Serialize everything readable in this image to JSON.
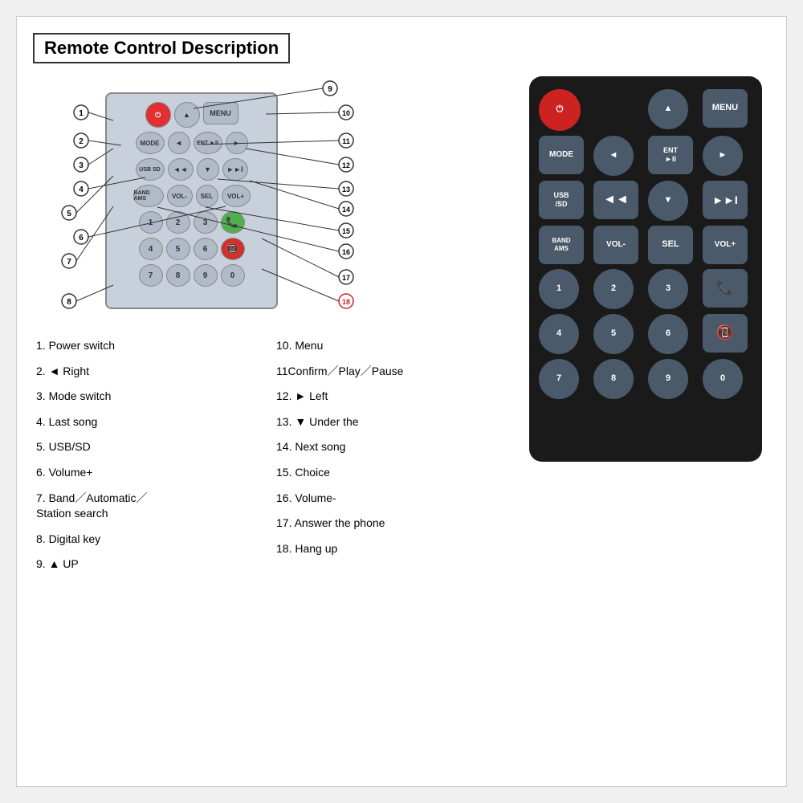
{
  "title": "Remote Control Description",
  "diagram": {
    "rows": [
      [
        "power",
        "▲",
        "MENU"
      ],
      [
        "MODE",
        "◄",
        "ENT ►II",
        "►"
      ],
      [
        "USB SD",
        "◄◄",
        "▼",
        "►►I"
      ],
      [
        "BAND AMS",
        "VOL-",
        "SEL",
        "VOL+"
      ],
      [
        "1",
        "2",
        "3",
        "✆"
      ],
      [
        "4",
        "5",
        "6",
        "📞"
      ],
      [
        "7",
        "8",
        "9",
        "0"
      ]
    ],
    "callouts": [
      {
        "num": "1",
        "label": ""
      },
      {
        "num": "2",
        "label": ""
      },
      {
        "num": "3",
        "label": ""
      },
      {
        "num": "4",
        "label": ""
      },
      {
        "num": "5",
        "label": ""
      },
      {
        "num": "6",
        "label": ""
      },
      {
        "num": "7",
        "label": ""
      },
      {
        "num": "8",
        "label": ""
      },
      {
        "num": "9",
        "label": ""
      },
      {
        "num": "10",
        "label": ""
      },
      {
        "num": "11",
        "label": ""
      },
      {
        "num": "12",
        "label": ""
      },
      {
        "num": "13",
        "label": ""
      },
      {
        "num": "14",
        "label": ""
      },
      {
        "num": "15",
        "label": ""
      },
      {
        "num": "16",
        "label": ""
      },
      {
        "num": "17",
        "label": ""
      },
      {
        "num": "18",
        "label": ""
      }
    ]
  },
  "descriptions_left": [
    {
      "num": "1",
      "text": "Power switch"
    },
    {
      "num": "2",
      "text": "◄ Right"
    },
    {
      "num": "3",
      "text": "Mode switch"
    },
    {
      "num": "4",
      "text": "Last song"
    },
    {
      "num": "5",
      "text": "USB/SD"
    },
    {
      "num": "6",
      "text": "Volume+"
    },
    {
      "num": "7",
      "text": "Band／Automatic／\n      Station search"
    },
    {
      "num": "8",
      "text": "Digital key"
    },
    {
      "num": "9",
      "text": "▲ UP"
    }
  ],
  "descriptions_right": [
    {
      "num": "10",
      "text": "Menu"
    },
    {
      "num": "11",
      "text": "Confirm／Play／Pause"
    },
    {
      "num": "12",
      "text": "► Left"
    },
    {
      "num": "13",
      "text": "▼ Under the"
    },
    {
      "num": "14",
      "text": "Next song"
    },
    {
      "num": "15",
      "text": "Choice"
    },
    {
      "num": "16",
      "text": "Volume-"
    },
    {
      "num": "17",
      "text": "Answer the phone"
    },
    {
      "num": "18",
      "text": "Hang up"
    }
  ],
  "colors": {
    "power_red": "#cc2222",
    "remote_bg": "#1a1a1a",
    "btn_bg": "#3a4a5a",
    "green_call": "#50dd50",
    "red_call": "#dd3030"
  }
}
